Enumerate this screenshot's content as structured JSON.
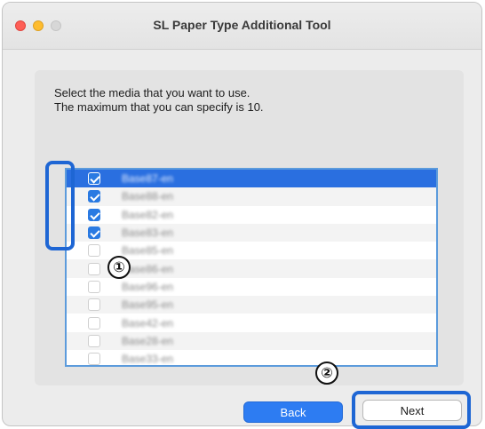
{
  "window": {
    "title": "SL Paper Type Additional Tool"
  },
  "instructions": {
    "line1": "Select the media that you want to use.",
    "line2": "The maximum that you can specify is 10."
  },
  "media_list": [
    {
      "label": "Base87-en",
      "checked": true,
      "selected": true
    },
    {
      "label": "Base88-en",
      "checked": true,
      "selected": false
    },
    {
      "label": "Base82-en",
      "checked": true,
      "selected": false
    },
    {
      "label": "Base83-en",
      "checked": true,
      "selected": false
    },
    {
      "label": "Base85-en",
      "checked": false,
      "selected": false
    },
    {
      "label": "Base86-en",
      "checked": false,
      "selected": false
    },
    {
      "label": "Base96-en",
      "checked": false,
      "selected": false
    },
    {
      "label": "Base95-en",
      "checked": false,
      "selected": false
    },
    {
      "label": "Base42-en",
      "checked": false,
      "selected": false
    },
    {
      "label": "Base28-en",
      "checked": false,
      "selected": false
    },
    {
      "label": "Base33-en",
      "checked": false,
      "selected": false
    }
  ],
  "callouts": {
    "one": "①",
    "two": "②"
  },
  "buttons": {
    "back": "Back",
    "next": "Next"
  },
  "colors": {
    "accent": "#2d7cf2",
    "highlight": "#1e66d4",
    "selection": "#2a6fe0"
  },
  "icons": {
    "close": "close-icon",
    "minimize": "minimize-icon",
    "zoom": "zoom-icon",
    "checkbox": "checkbox-icon"
  }
}
